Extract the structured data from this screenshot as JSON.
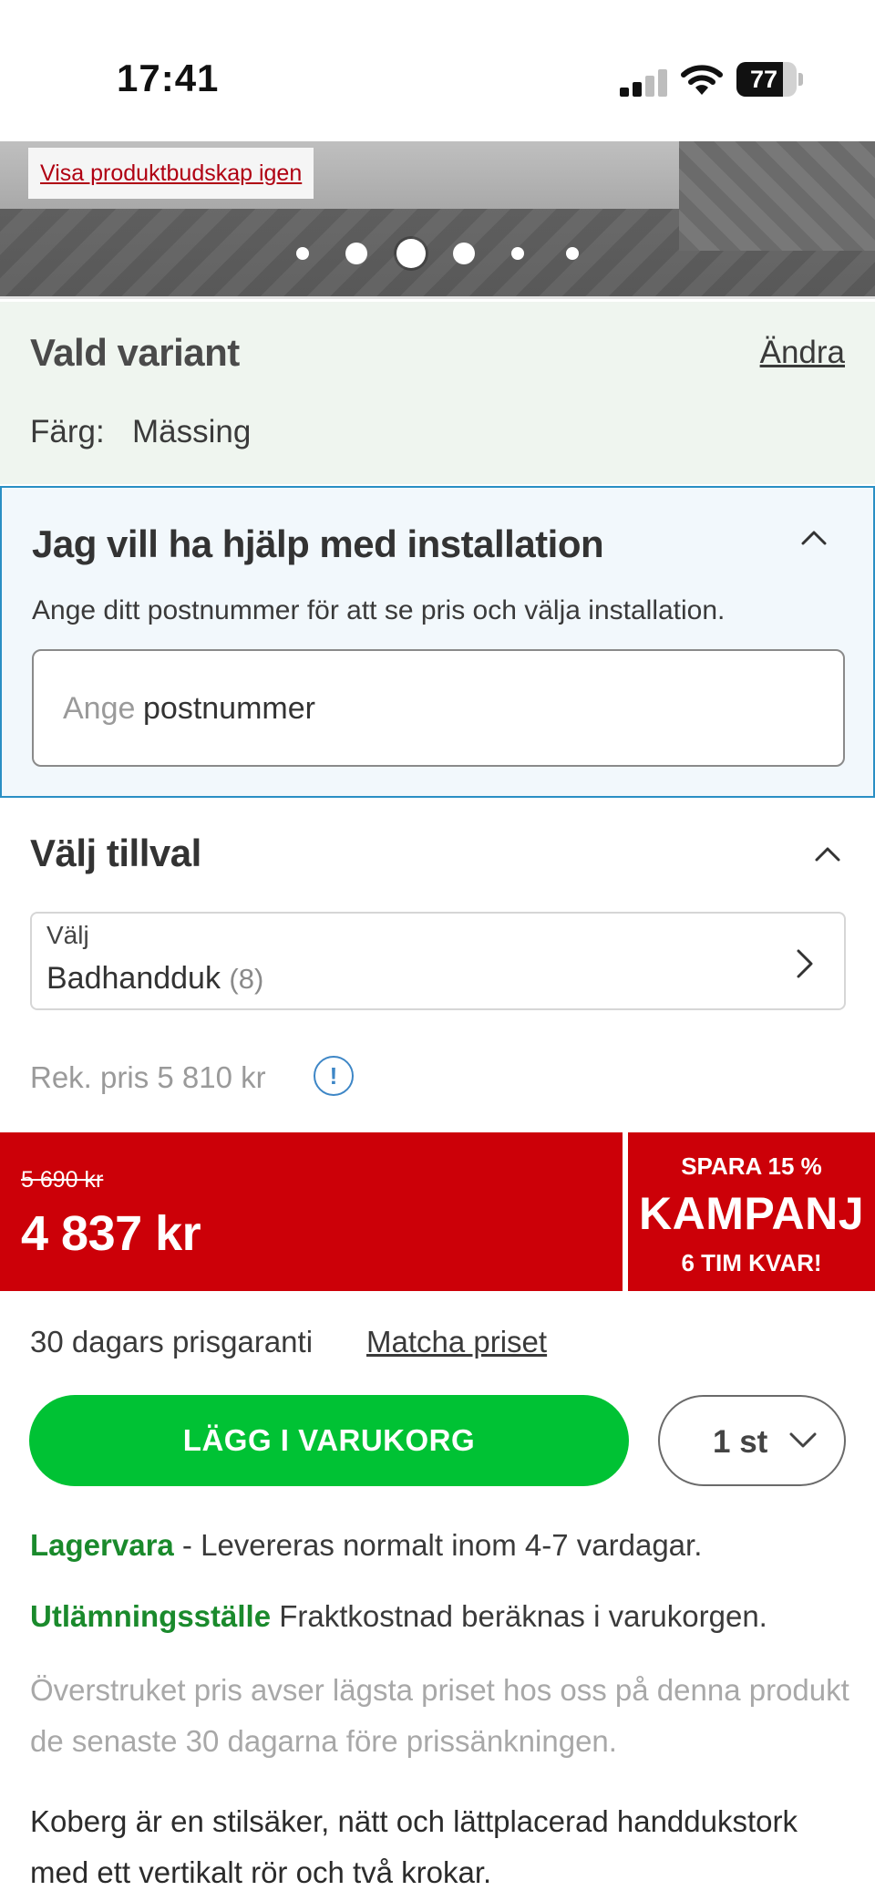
{
  "status_bar": {
    "time": "17:41",
    "battery": "77",
    "battery_level": 0.77
  },
  "hero": {
    "link": "Visa produktbudskap igen",
    "dots_total": 6,
    "active_dot": 3
  },
  "variant": {
    "title": "Vald variant",
    "change_link": "Ändra",
    "color_label": "Färg:",
    "color_value": "Mässing"
  },
  "installation": {
    "title": "Jag vill ha hjälp med installation",
    "description": "Ange ditt postnummer för att se pris och välja installation.",
    "zip_placeholder": "Ange",
    "zip_value": "postnummer"
  },
  "addons": {
    "title": "Välj tillval",
    "select_label": "Välj",
    "select_value": "Badhandduk",
    "select_count": "(8)"
  },
  "pricing": {
    "rek_price": "Rek. pris 5 810 kr",
    "info_symbol": "!",
    "old_price": "5 690 kr",
    "new_price": "4 837 kr",
    "promo_save": "SPARA 15 %",
    "promo_title": "KAMPANJ",
    "promo_time": "6 TIM KVAR!",
    "guarantee": "30 dagars prisgaranti",
    "match_link": "Matcha priset"
  },
  "cart": {
    "button_label": "LÄGG I VARUKORG",
    "quantity": "1 st"
  },
  "delivery": {
    "stock_label": "Lagervara",
    "stock_text": " - Levereras normalt inom 4-7 vardagar.",
    "pickup_label": "Utlämningsställe",
    "pickup_text": " Fraktkostnad beräknas i varukorgen."
  },
  "disclaimer": "Överstruket pris avser lägsta priset hos oss på denna produkt de senaste 30 dagarna före prissänkningen.",
  "description": "Koberg är en stilsäker, nätt och lättplacerad handdukstork med ett vertikalt rör och två krokar.",
  "colors": {
    "accent_red": "#cc0008",
    "cart_green": "#00c234",
    "stock_green": "#1a8a2c",
    "link_red": "#b00012",
    "install_border": "#2a8fc4",
    "variant_bg": "#eff5ef"
  },
  "icons": [
    "signal-icon",
    "wifi-icon",
    "battery-icon",
    "chevron-up-icon",
    "chevron-right-icon",
    "info-icon",
    "chevron-down-icon"
  ]
}
